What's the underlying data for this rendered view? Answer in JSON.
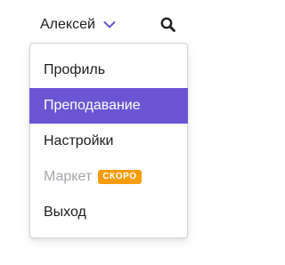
{
  "header": {
    "user_name": "Алексей",
    "chevron_icon": "chevron-down-icon",
    "search_icon": "search-icon",
    "accent_color": "#6b55d2"
  },
  "menu": {
    "items": [
      {
        "label": "Профиль",
        "state": "normal"
      },
      {
        "label": "Преподавание",
        "state": "active"
      },
      {
        "label": "Настройки",
        "state": "normal"
      },
      {
        "label": "Маркет",
        "state": "disabled",
        "badge": "СКОРО",
        "badge_color": "#f69c08"
      },
      {
        "label": "Выход",
        "state": "normal"
      }
    ],
    "active_color": "#6b55d2"
  }
}
